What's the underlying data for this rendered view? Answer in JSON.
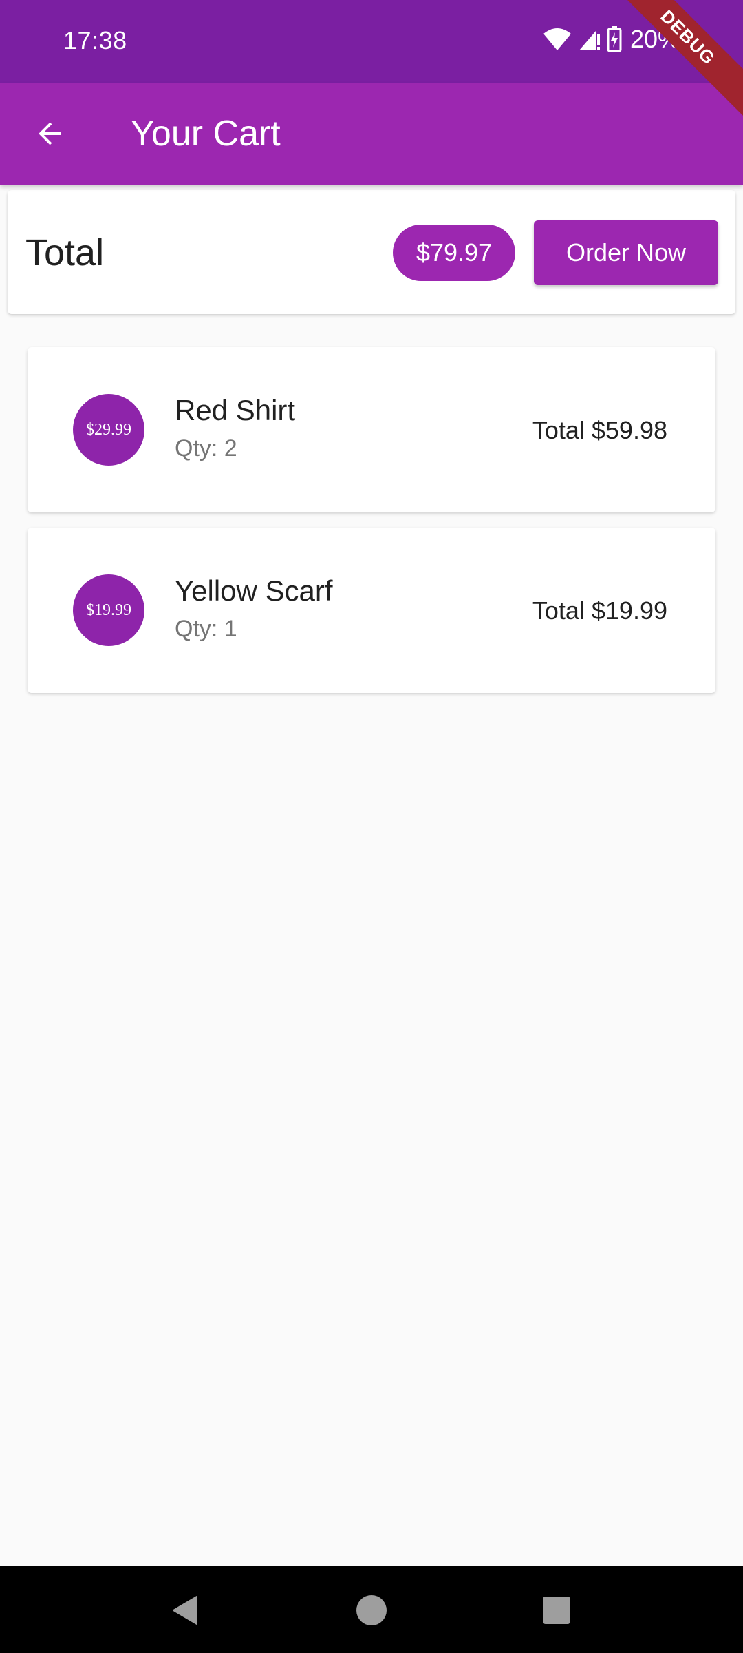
{
  "status_bar": {
    "time": "17:38",
    "battery_percent": "20%"
  },
  "debug_banner": "DEBUG",
  "app_bar": {
    "title": "Your Cart"
  },
  "summary": {
    "label": "Total",
    "amount": "$79.97",
    "order_button_label": "Order Now"
  },
  "cart_items": [
    {
      "price": "$29.99",
      "title": "Red Shirt",
      "qty": "Qty: 2",
      "total": "Total $59.98"
    },
    {
      "price": "$19.99",
      "title": "Yellow Scarf",
      "qty": "Qty: 1",
      "total": "Total $19.99"
    }
  ],
  "colors": {
    "primary": "#9c27b0",
    "primary_dark": "#7b1fa2",
    "avatar": "#8e24aa",
    "debug_banner": "#a0242e",
    "background": "#fafafa"
  }
}
